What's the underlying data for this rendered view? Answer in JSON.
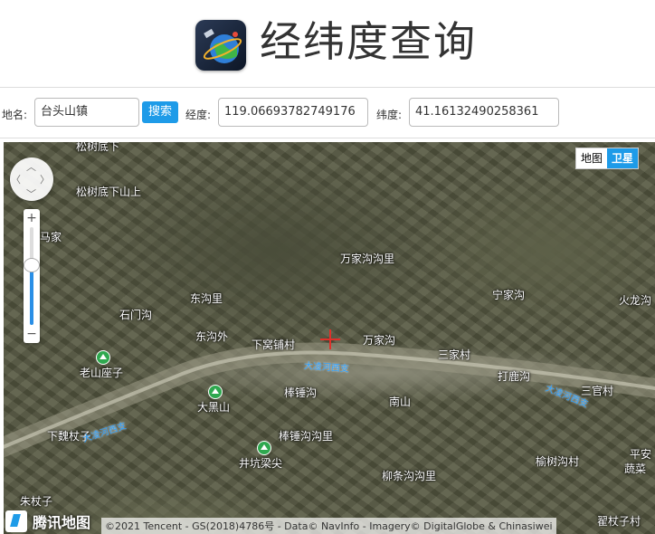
{
  "header": {
    "title": "经纬度查询",
    "logo_icon": "globe-satellite-icon"
  },
  "form": {
    "place_label": "地名:",
    "place_value": "台头山镇",
    "search_label": "搜索",
    "lng_label": "经度:",
    "lng_value": "119.06693782749176",
    "lat_label": "纬度:",
    "lat_value": "41.16132490258361"
  },
  "map": {
    "type_buttons": [
      "地图",
      "卫星"
    ],
    "active_type": "卫星",
    "zoom_level_fraction": 0.62,
    "pan_arrows": {
      "up": "︿",
      "down": "﹀",
      "left": "〈",
      "right": "〉"
    },
    "zoom_in": "+",
    "zoom_out": "−",
    "places": [
      "松树底下",
      "松树底下山上",
      "马家",
      "万家沟沟里",
      "宁家沟",
      "火龙沟",
      "东沟里",
      "石门沟",
      "东沟外",
      "下窝铺村",
      "万家沟",
      "三家村",
      "老山座子",
      "打鹿沟",
      "三官村",
      "大黑山",
      "棒锤沟",
      "南山",
      "下魏杖子",
      "棒锤沟沟里",
      "井坑梁尖",
      "榆树沟村",
      "平安",
      "蔬菜",
      "柳条沟沟里",
      "朱杖子",
      "翟杖子村"
    ],
    "roads": [
      "大凌河西支",
      "大凌河西支",
      "大凌河西支"
    ],
    "brand": "腾讯地图",
    "copyright": "©2021 Tencent - GS(2018)4786号 - Data© NavInfo - Imagery© DigitalGlobe & Chinasiwei"
  }
}
